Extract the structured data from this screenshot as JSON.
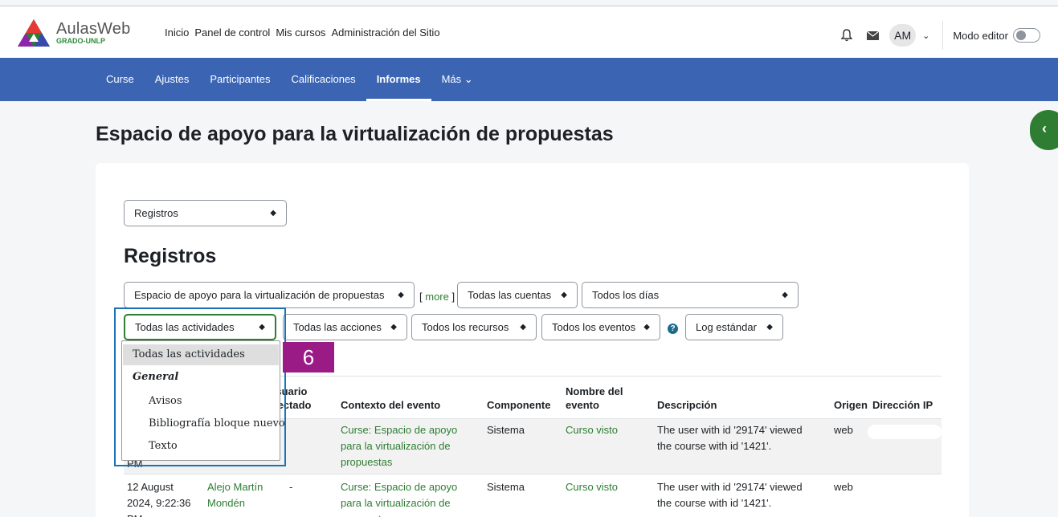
{
  "brand": {
    "name": "AulasWeb",
    "sub": "GRADO-UNLP"
  },
  "topnav": [
    "Inicio",
    "Panel de control",
    "Mis cursos",
    "Administración del Sitio"
  ],
  "user": {
    "initials": "AM",
    "editor_mode_label": "Modo editor",
    "editor_mode_on": false
  },
  "secondary_nav": [
    {
      "label": "Curse",
      "active": false
    },
    {
      "label": "Ajustes",
      "active": false
    },
    {
      "label": "Participantes",
      "active": false
    },
    {
      "label": "Calificaciones",
      "active": false
    },
    {
      "label": "Informes",
      "active": true
    },
    {
      "label": "Más",
      "active": false
    }
  ],
  "page_title": "Espacio de apoyo para la virtualización de propuestas",
  "report_select": "Registros",
  "section_title": "Registros",
  "filters": {
    "course": "Espacio de apoyo para la virtualización de propuestas",
    "more": "more",
    "accounts": "Todas las cuentas",
    "days": "Todos los días",
    "activities": "Todas las actividades",
    "actions": "Todas las acciones",
    "resources": "Todos los recursos",
    "events": "Todos los eventos",
    "log": "Log estándar"
  },
  "dropdown": {
    "options": [
      {
        "label": "Todas las actividades",
        "kind": "selected"
      },
      {
        "label": "General",
        "kind": "group"
      },
      {
        "label": "Avisos",
        "kind": "child"
      },
      {
        "label": "Bibliografía bloque nuevo",
        "kind": "child"
      },
      {
        "label": "Texto",
        "kind": "child"
      }
    ],
    "step_badge": "6"
  },
  "table": {
    "headers": {
      "affected_user": [
        "Usuario",
        "afectado"
      ],
      "context": "Contexto del evento",
      "component": "Componente",
      "event_name": [
        "Nombre del",
        "evento"
      ],
      "description": "Descripción",
      "origin": "Origen",
      "ip": "Dirección IP"
    },
    "rows": [
      {
        "time": [
          "",
          "",
          "PM"
        ],
        "user": "",
        "affected": "",
        "context": [
          "Curse: Espacio de apoyo",
          "para la virtualización de",
          "propuestas"
        ],
        "component": "Sistema",
        "event": "Curso visto",
        "description": [
          "The user with id '29174' viewed",
          "the course with id '1421'."
        ],
        "origin": "web"
      },
      {
        "time": [
          "12 August",
          "2024, 9:22:36",
          "PM"
        ],
        "user": [
          "Alejo Martín",
          "Mondén"
        ],
        "affected": "-",
        "context": [
          "Curse: Espacio de apoyo",
          "para la virtualización de",
          "propuestas"
        ],
        "component": "Sistema",
        "event": "Curso visto",
        "description": [
          "The user with id '29174' viewed",
          "the course with id '1421'."
        ],
        "origin": "web"
      }
    ]
  }
}
